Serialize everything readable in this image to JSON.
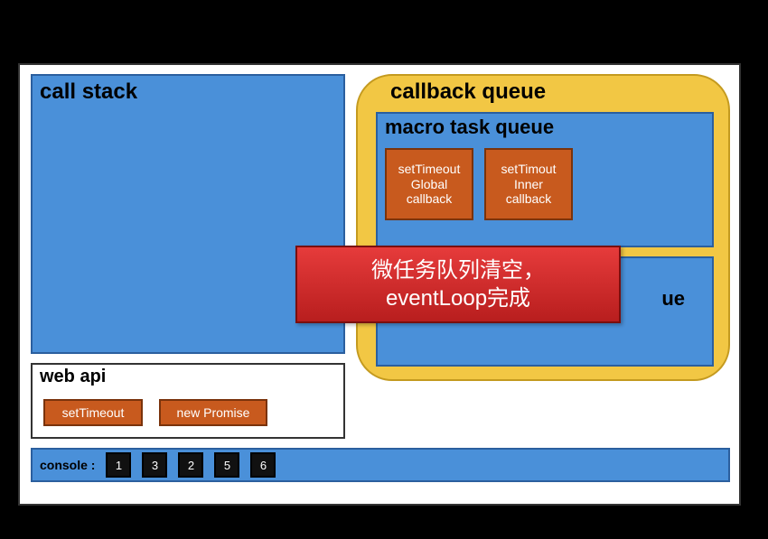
{
  "call_stack": {
    "title": "call  stack"
  },
  "callback_queue": {
    "title": "callback queue",
    "macro": {
      "title": "macro task queue",
      "items": [
        "setTimeout Global callback",
        "setTimout Inner callback"
      ]
    },
    "micro": {
      "title_fragment": "ue"
    }
  },
  "web_api": {
    "title": "web api",
    "items": [
      "setTimeout",
      "new Promise"
    ]
  },
  "console": {
    "label": "console :",
    "outputs": [
      "1",
      "3",
      "2",
      "5",
      "6"
    ]
  },
  "overlay": {
    "line1": "微任务队列清空，",
    "line2": "eventLoop完成"
  }
}
